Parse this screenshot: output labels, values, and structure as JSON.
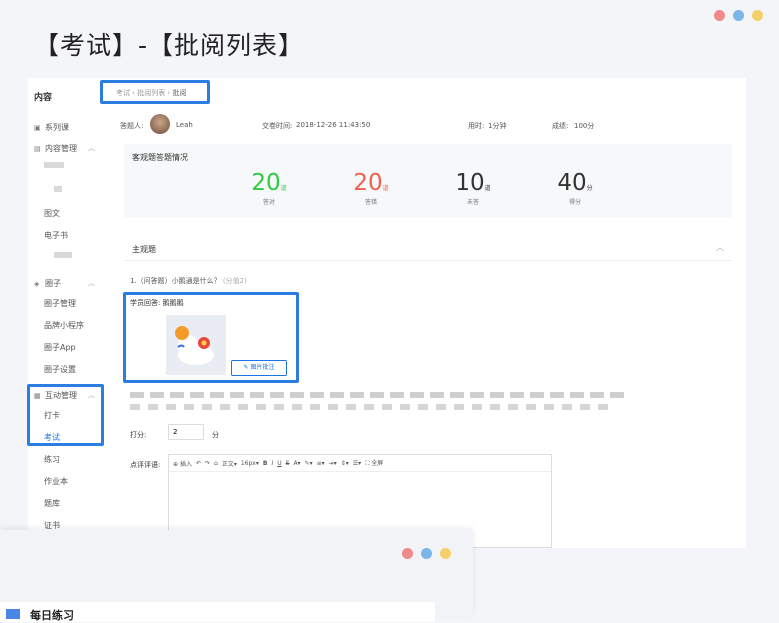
{
  "window_dots": [
    "#f08a8a",
    "#7ab6e8",
    "#f4d06a"
  ],
  "title": "【考试】-【批阅列表】",
  "sidebar": {
    "heading": "内容",
    "items": [
      {
        "label": "系列课",
        "icon": "course-icon"
      },
      {
        "label": "内容管理",
        "icon": "content-icon"
      },
      {
        "label": "图文"
      },
      {
        "label": "电子书"
      },
      {
        "label": "圈子",
        "icon": "circle-icon"
      },
      {
        "label": "圈子管理"
      },
      {
        "label": "品牌小程序"
      },
      {
        "label": "圈子App"
      },
      {
        "label": "圈子设置"
      },
      {
        "label": "互动管理",
        "icon": "interaction-icon"
      },
      {
        "label": "打卡"
      },
      {
        "label": "考试"
      },
      {
        "label": "练习"
      },
      {
        "label": "作业本"
      },
      {
        "label": "题库"
      },
      {
        "label": "证书"
      }
    ]
  },
  "breadcrumb": [
    "考试",
    "批阅列表",
    "批阅"
  ],
  "info": {
    "answerer_label": "答题人:",
    "answerer_name": "Leah",
    "submit_label": "交卷时间:",
    "submit_time": "2018-12-26  11:43:50",
    "duration_label": "用时:",
    "duration": "1分钟",
    "score_label": "成绩:",
    "score": "100分"
  },
  "objective": {
    "title": "客观题答题情况",
    "stats": [
      {
        "value": "20",
        "unit": "道",
        "label": "答对",
        "color": "#2ecc40"
      },
      {
        "value": "20",
        "unit": "道",
        "label": "答错",
        "color": "#f0604d"
      },
      {
        "value": "10",
        "unit": "道",
        "label": "未答",
        "color": "#333333"
      },
      {
        "value": "40",
        "unit": "分",
        "label": "得分",
        "color": "#333333"
      }
    ]
  },
  "subjective": {
    "title": "主观题",
    "question": "1.（问答题）小鹅通是什么？",
    "question_score": "(分值2)",
    "answer_label": "学员回答:",
    "answer_text": "鹅鹅鹅",
    "annotate_button": "图片批注",
    "score_label": "打分:",
    "score_value": "2",
    "score_unit": "分",
    "comment_label": "点评评语:"
  },
  "toolbar": {
    "insert": "插入",
    "paragraph": "正文",
    "font_size": "16px",
    "fullscreen": "全屏"
  },
  "overlay": {
    "title": "每日练习"
  },
  "highlight_color": "#2a7de1"
}
